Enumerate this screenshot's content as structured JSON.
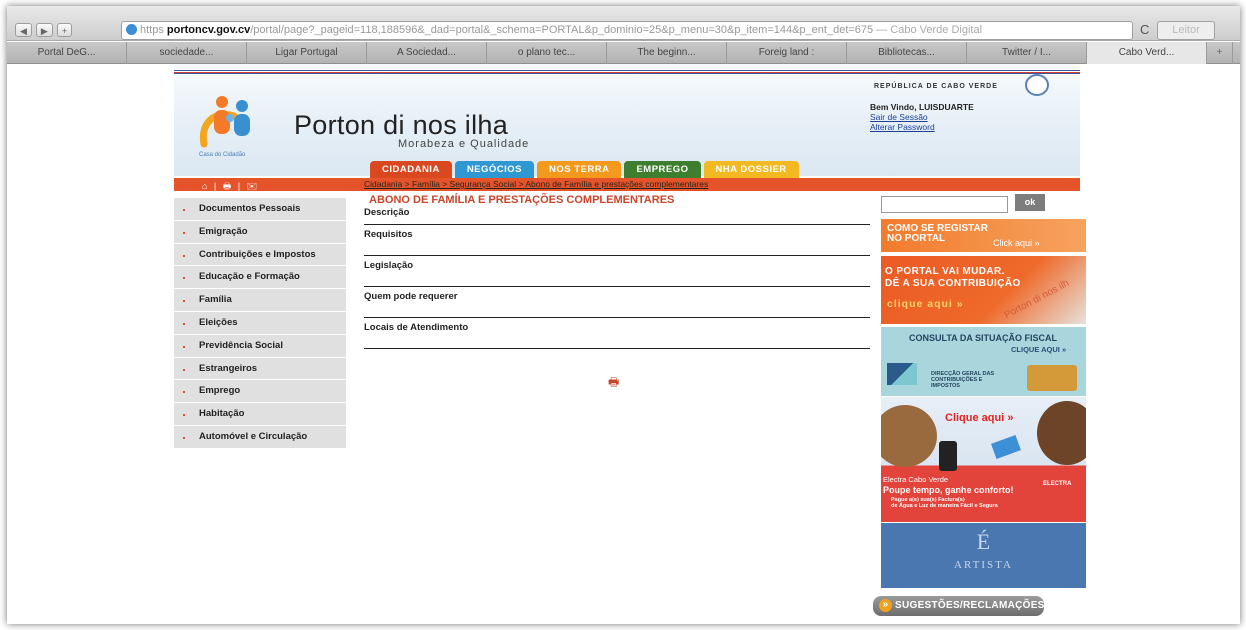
{
  "browser": {
    "nav_back": "◀",
    "nav_forward": "▶",
    "nav_plus": "+",
    "url_prefix": "https",
    "url_host": "portoncv.gov.cv",
    "url_path": "/portal/page?_pageid=118,188596&_dad=portal&_schema=PORTAL&p_dominio=25&p_menu=30&p_item=144&p_ent_det=675",
    "page_title": " — Cabo Verde Digital",
    "reload": "C",
    "reader": "Leitor",
    "tabs": [
      "Portal DeG...",
      "sociedade...",
      "Ligar Portugal",
      "A Sociedad...",
      "o plano tec...",
      "The beginn...",
      "Foreig land :",
      "Bibliotecas...",
      "Twitter / I...",
      "Cabo Verd...",
      "+"
    ]
  },
  "header": {
    "republic": "REPÚBLICA DE CABO VERDE",
    "brand_title": "Porton di nos ilha",
    "brand_sub": "Morabeza e Qualidade",
    "logo_caption": "Casa do Cidadão",
    "welcome": "Bem Vindo, LUISDUARTE",
    "logout": "Sair de Sessão",
    "change_password": "Alterar Password"
  },
  "main_tabs": [
    {
      "label": "CIDADANIA",
      "color": "#d9481f"
    },
    {
      "label": "NEGÓCIOS",
      "color": "#2f98d2"
    },
    {
      "label": "NOS TERRA",
      "color": "#f39a1c"
    },
    {
      "label": "EMPREGO",
      "color": "#3e7f2f"
    },
    {
      "label": "NHA DOSSIER",
      "color": "#f2b922"
    }
  ],
  "toolbar_icons": "⌂ | 🖶 | ✉",
  "breadcrumb": "Cidadania > Família > Segurança Social > Abono de Família e prestações complementares",
  "sidebar": [
    "Documentos Pessoais",
    "Emigração",
    "Contribuições e Impostos",
    "Educação e Formação",
    "Família",
    "Eleições",
    "Previdência Social",
    "Estrangeiros",
    "Emprego",
    "Habitação",
    "Automóvel e Circulação"
  ],
  "content": {
    "title": "ABONO DE FAMÍLIA E PRESTAÇÕES COMPLEMENTARES",
    "sections": [
      "Descrição",
      "Requisitos",
      "Legislação",
      "Quem pode requerer",
      "Locais de Atendimento"
    ],
    "print_icon": "🖶"
  },
  "right": {
    "search_value": "",
    "ok": "ok",
    "ad1_line1": "COMO SE REGISTAR",
    "ad1_line2": "NO PORTAL",
    "ad1_cta": "Click aqui »",
    "ad2_line1": "O PORTAL VAI MUDAR.",
    "ad2_line2": "DÊ A SUA CONTRIBUIÇÃO",
    "ad2_cta": "clique aqui »",
    "ad2_watermark": "Porton di nos ilh",
    "ad3_title": "CONSULTA DA SITUAÇÃO FISCAL",
    "ad3_cta": "CLIQUE AQUI »",
    "ad3_org": "DIRECÇÃO GERAL DAS\nCONTRIBUIÇÕES E\nIMPOSTOS",
    "ad4_cta": "Clique aqui »",
    "ad4_brand": "Electra   Cabo Verde",
    "ad4_line1": "Poupe tempo, ganhe conforto!",
    "ad4_line2": "Pague a(s) sua(s) Factura(s)\nde Água e Luz de maneira Fácil e Segura",
    "ad4_logo": "ELECTRA",
    "ad5_big": "É",
    "ad5_small": "ARTISTA",
    "suggestions": "SUGESTÕES/RECLAMAÇÕES"
  }
}
